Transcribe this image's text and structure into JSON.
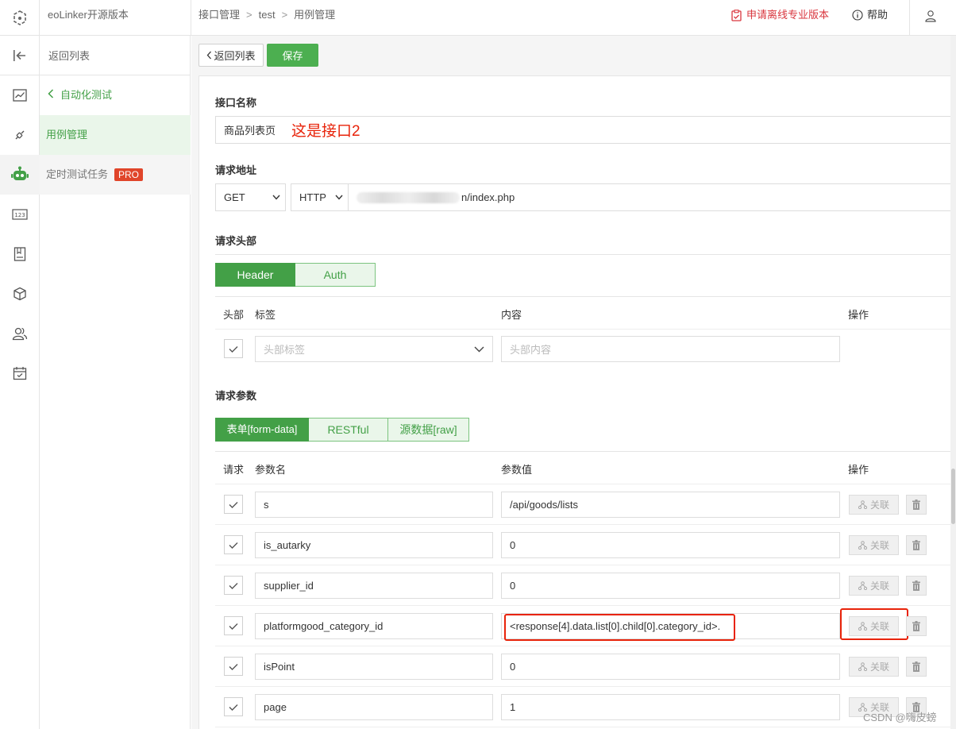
{
  "topbar": {
    "app_name": "eoLinker开源版本",
    "breadcrumb": [
      "接口管理",
      "test",
      "用例管理"
    ],
    "breadcrumb_sep": ">",
    "apply_pro": "申请离线专业版本",
    "help": "帮助"
  },
  "side": {
    "back": "返回列表",
    "group": "自动化测试",
    "items": [
      {
        "label": "用例管理",
        "selected": true
      },
      {
        "label": "定时测试任务",
        "badge": "PRO"
      }
    ]
  },
  "rail_icons": [
    "chart-icon",
    "plug-icon",
    "robot-icon",
    "number-icon",
    "document-icon",
    "cube-icon",
    "users-icon",
    "calendar-icon"
  ],
  "toolbar": {
    "back": "返回列表",
    "save": "保存"
  },
  "api_name": {
    "title": "接口名称",
    "value": "商品列表页",
    "annotation": "这是接口2"
  },
  "request_url": {
    "title": "请求地址",
    "method": "GET",
    "protocol": "HTTP",
    "url_suffix": "n/index.php"
  },
  "headers": {
    "title": "请求头部",
    "tabs": [
      "Header",
      "Auth"
    ],
    "active_tab": 0,
    "columns": [
      "头部",
      "标签",
      "内容",
      "操作"
    ],
    "label_placeholder": "头部标签",
    "content_placeholder": "头部内容"
  },
  "params": {
    "title": "请求参数",
    "tabs": [
      "表单[form-data]",
      "RESTful",
      "源数据[raw]"
    ],
    "active_tab": 0,
    "columns": [
      "请求",
      "参数名",
      "参数值",
      "操作"
    ],
    "link_label": "关联",
    "rows": [
      {
        "name": "s",
        "value": "/api/goods/lists"
      },
      {
        "name": "is_autarky",
        "value": "0"
      },
      {
        "name": "supplier_id",
        "value": "0"
      },
      {
        "name": "platformgood_category_id",
        "value": "<response[4].data.list[0].child[0].category_id>."
      },
      {
        "name": "isPoint",
        "value": "0"
      },
      {
        "name": "page",
        "value": "1"
      }
    ]
  },
  "watermark": "CSDN @嗨皮螃",
  "colors": {
    "accent": "#43a047",
    "danger": "#e8230a",
    "pro_badge": "#e0452a"
  }
}
